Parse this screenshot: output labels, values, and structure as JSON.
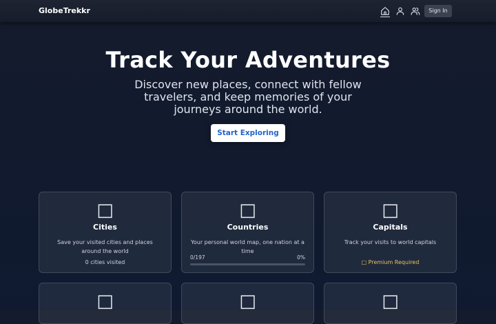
{
  "app": {
    "brand": "GlobeTrekkr"
  },
  "nav": {
    "icons": [
      "home-icon",
      "user-icon",
      "users-icon"
    ],
    "signin_label": "Sign In"
  },
  "hero": {
    "title": "Track Your Adventures",
    "subtitle": "Discover new places, connect with fellow travelers, and keep memories of your journeys around the world.",
    "cta_label": "Start Exploring"
  },
  "cards": [
    {
      "icon": "□",
      "title": "Cities",
      "description": "Save your visited cities and places around the world",
      "stat": "0 cities visited"
    },
    {
      "icon": "□",
      "title": "Countries",
      "description": "Your personal world map, one nation at a time",
      "progress_label": "0/197",
      "progress_percent_label": "0%",
      "progress": 0
    },
    {
      "icon": "□",
      "title": "Capitals",
      "description": "Track your visits to world capitals",
      "premium_label": "□ Premium Required"
    }
  ],
  "cards_row2": [
    {
      "icon": "□"
    },
    {
      "icon": "□"
    },
    {
      "icon": "□"
    }
  ],
  "colors": {
    "cta_text": "#2563c9",
    "premium": "#e6c35c",
    "background": "#111a2e"
  }
}
